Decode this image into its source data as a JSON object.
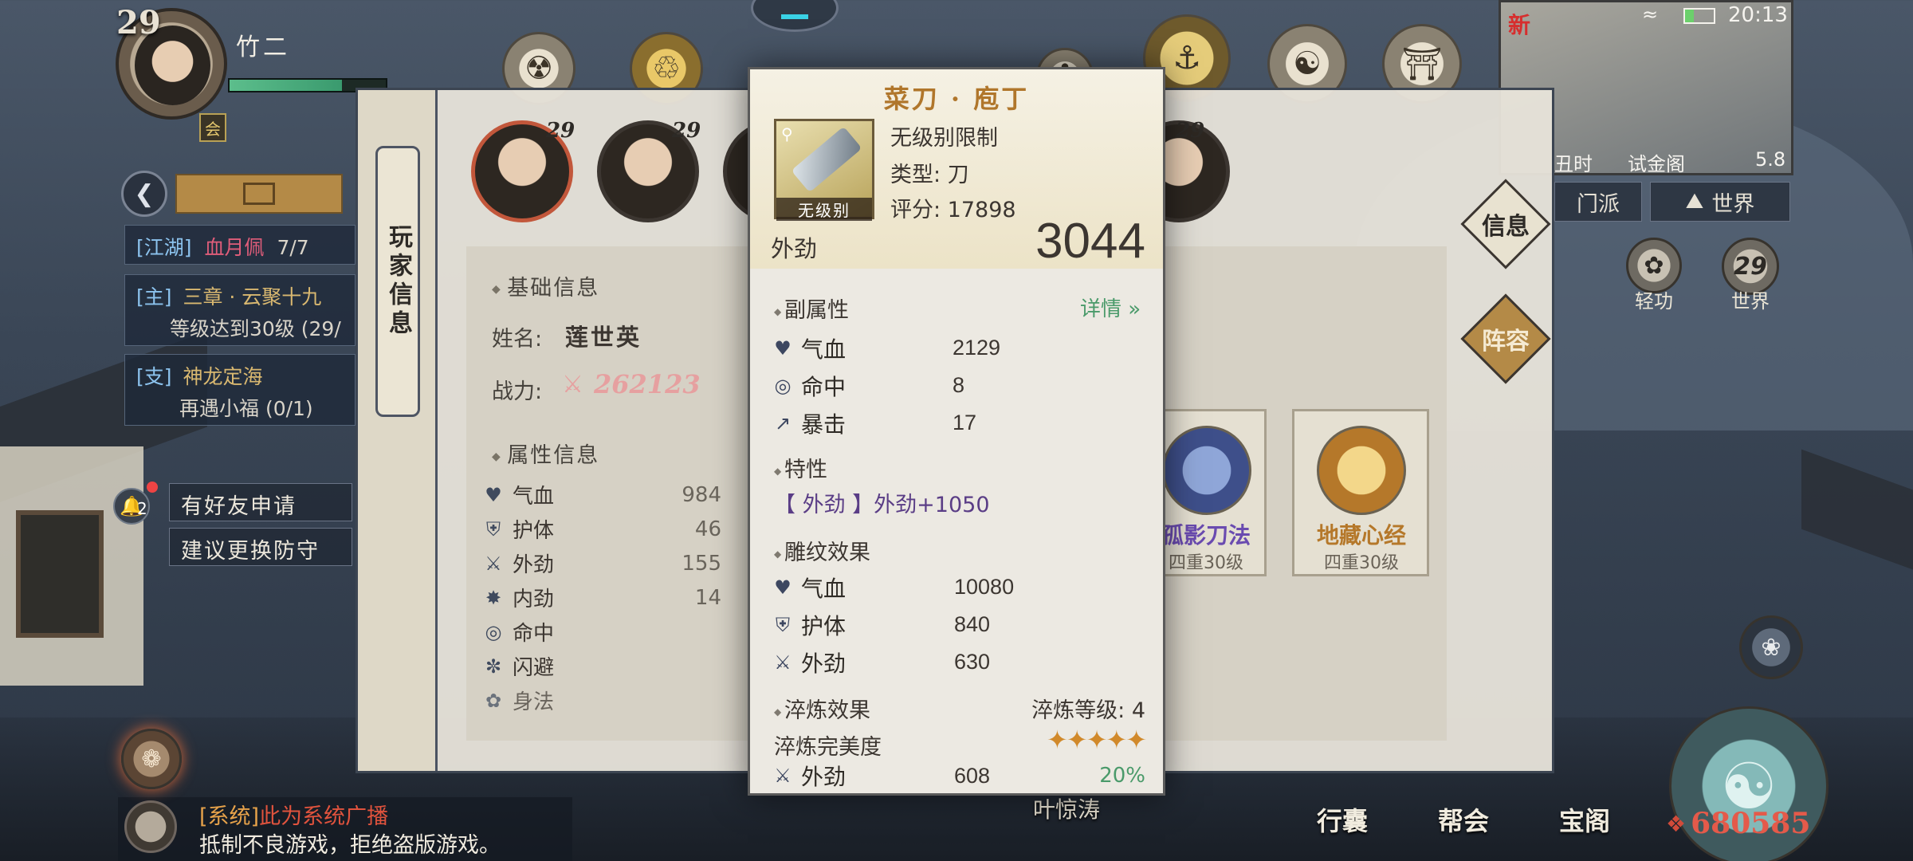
{
  "player": {
    "level": "29",
    "name": "竹二",
    "hp_fraction": 0.72,
    "vip_badge": "会"
  },
  "status_bar": {
    "new_badge": "新",
    "time": "20:13"
  },
  "minimap": {
    "time_label": "丑时",
    "location": "试金阁",
    "distance": "5.8"
  },
  "quests": [
    {
      "tag": "[江湖]",
      "name": "血月佩",
      "progress": "7/7"
    },
    {
      "tag": "[主]",
      "name": "三章 · 云聚十九",
      "detail": "等级达到30级 (29/"
    },
    {
      "tag": "[支]",
      "name": "神龙定海",
      "detail": "再遇小福 (0/1)"
    }
  ],
  "notices": {
    "count": "2",
    "friend_request": "有好友申请",
    "suggest_armor": "建议更换防守"
  },
  "top_right_tabs": {
    "sect": "门派",
    "world": "世界"
  },
  "side_buttons": {
    "qinggong": "轻功",
    "world": "世界",
    "world_level": "29"
  },
  "chat": {
    "channel": "[系统]",
    "title": "此为系统广播",
    "message": "抵制不良游戏，拒绝盗版游戏。"
  },
  "bottom_bar": {
    "bag": "行囊",
    "guild": "帮会",
    "treasure": "宝阁",
    "power": "680585",
    "npc_name": "叶惊涛"
  },
  "panel": {
    "spine_tab": "玩家信息",
    "heroes": [
      {
        "level": "29"
      },
      {
        "level": "29"
      },
      {
        "level": ""
      },
      {
        "level": "29"
      }
    ],
    "basic_info": "基础信息",
    "name_label": "姓名:",
    "name_value": "莲世英",
    "power_label": "战力:",
    "power_value": "262123",
    "attr_title": "属性信息",
    "attrs": [
      {
        "icon": "heart",
        "name": "气血",
        "value": "984"
      },
      {
        "icon": "shield",
        "name": "护体",
        "value": "46"
      },
      {
        "icon": "sword",
        "name": "外劲",
        "value": "155"
      },
      {
        "icon": "swirl",
        "name": "内劲",
        "value": "14"
      },
      {
        "icon": "target",
        "name": "命中",
        "value": ""
      },
      {
        "icon": "dodge",
        "name": "闪避",
        "value": ""
      },
      {
        "icon": "body",
        "name": "身法",
        "value": ""
      }
    ],
    "right_tabs": {
      "info": "信息",
      "lineup": "阵容"
    },
    "skills": [
      {
        "name": "孤影刀法",
        "level": "四重30级",
        "color": "#6a4bb0"
      },
      {
        "name": "地藏心经",
        "level": "四重30级",
        "color": "#b5782a"
      }
    ]
  },
  "tooltip": {
    "item_name": "菜刀 · 庖丁",
    "item_badge": "无级别",
    "level_limit": "无级别限制",
    "type": "类型: 刀",
    "score": "评分: 17898",
    "main_stat_name": "外劲",
    "main_stat_value": "3044",
    "sub_title": "副属性",
    "detail_link": "详情",
    "sub_stats": [
      {
        "icon": "heart",
        "name": "气血",
        "value": "2129"
      },
      {
        "icon": "target",
        "name": "命中",
        "value": "8"
      },
      {
        "icon": "crit",
        "name": "暴击",
        "value": "17"
      }
    ],
    "trait_title": "特性",
    "trait_text": "【 外劲 】外劲+1050",
    "engrave_title": "雕纹效果",
    "engrave_stats": [
      {
        "icon": "heart",
        "name": "气血",
        "value": "10080"
      },
      {
        "icon": "shield",
        "name": "护体",
        "value": "840"
      },
      {
        "icon": "sword",
        "name": "外劲",
        "value": "630"
      }
    ],
    "refine_title": "淬炼效果",
    "refine_level": "淬炼等级: 4",
    "perfection_label": "淬炼完美度",
    "perfection_stars": 5,
    "refine_stat": {
      "name": "外劲",
      "value": "608",
      "percent": "20%"
    }
  },
  "colors": {
    "accent_gold": "#b0762b",
    "link_green": "#4a9a6a",
    "trait_purple": "#5a3d86",
    "chat_red": "#e0533d"
  }
}
